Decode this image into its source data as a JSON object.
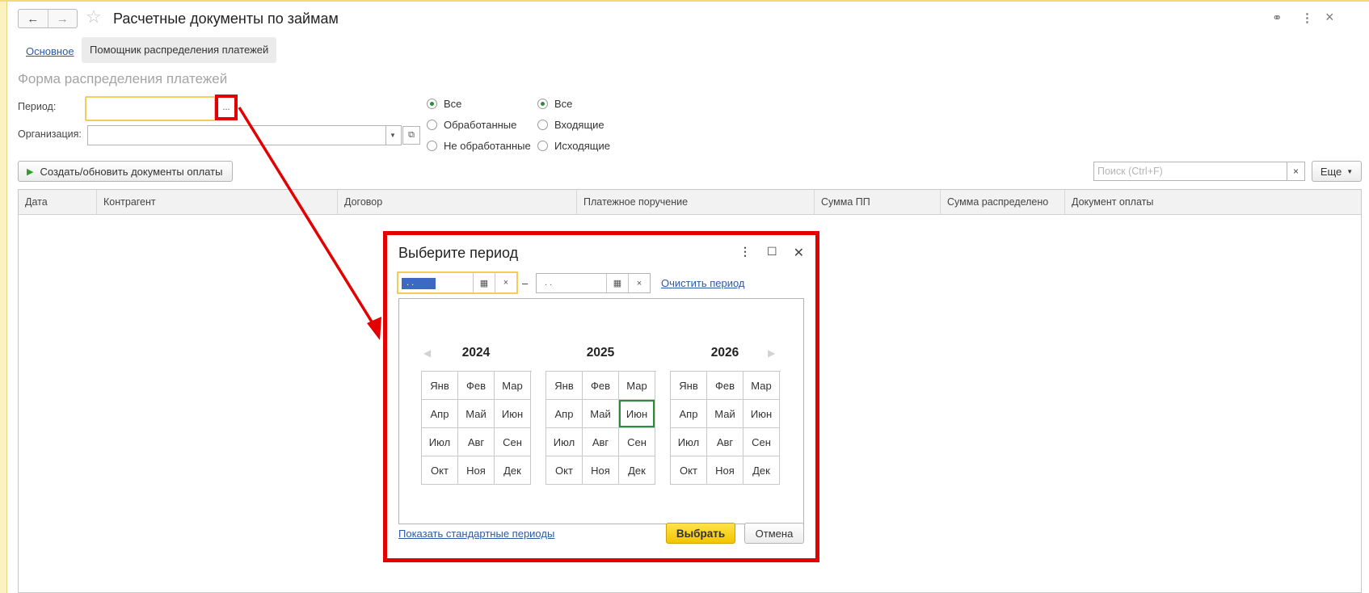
{
  "window": {
    "title": "Расчетные документы по займам"
  },
  "header": {
    "back_icon": "←",
    "forward_icon": "→",
    "star_icon": "☆",
    "link_icon": "⚭",
    "menu_icon": "⋮",
    "close_icon": "×"
  },
  "tabs": [
    {
      "label": "Основное"
    },
    {
      "label": "Помощник распределения платежей"
    }
  ],
  "form": {
    "title": "Форма распределения платежей",
    "period_label": "Период:",
    "period_value": "",
    "period_button": "...",
    "org_label": "Организация:",
    "org_value": ""
  },
  "filters": {
    "status": [
      {
        "label": "Все",
        "selected": true
      },
      {
        "label": "Обработанные",
        "selected": false
      },
      {
        "label": "Не обработанные",
        "selected": false
      }
    ],
    "direction": [
      {
        "label": "Все",
        "selected": true
      },
      {
        "label": "Входящие",
        "selected": false
      },
      {
        "label": "Исходящие",
        "selected": false
      }
    ]
  },
  "toolbar": {
    "create_label": "Создать/обновить документы оплаты",
    "search_placeholder": "Поиск (Ctrl+F)",
    "more_label": "Еще"
  },
  "table": {
    "columns": [
      "Дата",
      "Контрагент",
      "Договор",
      "Платежное поручение",
      "Сумма ПП",
      "Сумма распределено",
      "Документ оплаты"
    ],
    "rows": []
  },
  "dialog": {
    "title": "Выберите период",
    "start_date": " .  .",
    "end_date": " .  .",
    "dash": "–",
    "clear_link": "Очистить период",
    "years": [
      {
        "year": "2024",
        "months": [
          "Янв",
          "Фев",
          "Мар",
          "Апр",
          "Май",
          "Июн",
          "Июл",
          "Авг",
          "Сен",
          "Окт",
          "Ноя",
          "Дек"
        ],
        "selected_index": -1
      },
      {
        "year": "2025",
        "months": [
          "Янв",
          "Фев",
          "Мар",
          "Апр",
          "Май",
          "Июн",
          "Июл",
          "Авг",
          "Сен",
          "Окт",
          "Ноя",
          "Дек"
        ],
        "selected_index": 5
      },
      {
        "year": "2026",
        "months": [
          "Янв",
          "Фев",
          "Мар",
          "Апр",
          "Май",
          "Июн",
          "Июл",
          "Авг",
          "Сен",
          "Окт",
          "Ноя",
          "Дек"
        ],
        "selected_index": -1
      }
    ],
    "std_periods_link": "Показать стандартные периоды",
    "ok_label": "Выбрать",
    "cancel_label": "Отмена"
  },
  "colors": {
    "accent": "#e30000",
    "primary_button": "#f3c500",
    "selection": "#2e8b3c",
    "link": "#2a5aa8",
    "field_focus": "#f5cb5c"
  }
}
